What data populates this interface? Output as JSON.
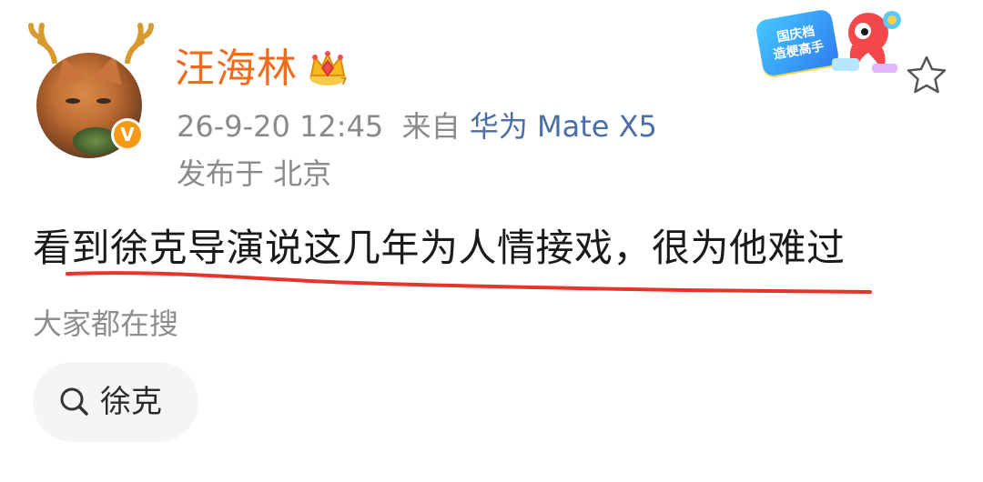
{
  "post": {
    "author": {
      "name": "汪海林",
      "verified_badge_glyph": "V",
      "avatar_icon": "cat-avatar",
      "decoration_icon": "antlers-icon",
      "member_icon": "crown-icon"
    },
    "timestamp": "26-9-20 12:45",
    "source_prefix": "来自",
    "device": "华为 Mate X5",
    "location": "发布于 北京",
    "text": "看到徐克导演说这几年为人情接戏，很为他难过",
    "favorite_icon": "star-outline-icon",
    "promo_badge": {
      "line1": "国庆档",
      "line2": "造梗高手"
    }
  },
  "search": {
    "heading": "大家都在搜",
    "chip_label": "徐克",
    "chip_icon": "search-icon"
  },
  "colors": {
    "username": "#f26a1b",
    "device_link": "#4a6ea8",
    "meta_text": "#8a8a8a",
    "underline_annotation": "#e5352b",
    "verified_badge": "#f59a14"
  }
}
